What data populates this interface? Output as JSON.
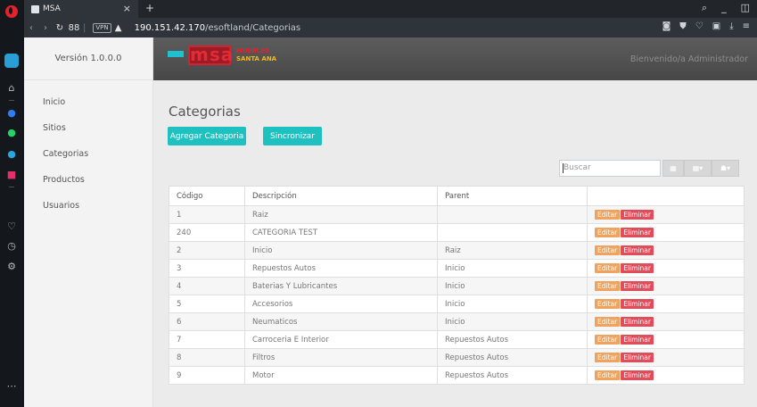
{
  "browser": {
    "tab_title": "MSA",
    "tab_close": "×",
    "new_tab": "+",
    "speed_dial": "88",
    "vpn_label": "VPN",
    "url_host": "190.151.42.170",
    "url_path": "/esoftland/Categorias"
  },
  "sidebar": {
    "version": "Versión 1.0.0.0",
    "items": [
      {
        "label": "Inicio"
      },
      {
        "label": "Sitios"
      },
      {
        "label": "Categorias"
      },
      {
        "label": "Productos"
      },
      {
        "label": "Usuarios"
      }
    ]
  },
  "header": {
    "logo_text": "msa",
    "logo_sub_line1": "MUEBLES",
    "logo_sub_line2": "SANTA ANA",
    "welcome": "Bienvenido/a Administrador"
  },
  "main": {
    "title": "Categorias",
    "add_button": "Agregar Categoria",
    "sync_button": "Sincronizar",
    "search_placeholder": "Buscar",
    "table": {
      "headers": [
        "Código",
        "Descripción",
        "Parent",
        ""
      ],
      "edit_label": "Editar",
      "delete_label": "Eliminar",
      "rows": [
        {
          "codigo": "1",
          "descripcion": "Raiz",
          "parent": ""
        },
        {
          "codigo": "240",
          "descripcion": "CATEGORIA TEST",
          "parent": ""
        },
        {
          "codigo": "2",
          "descripcion": "Inicio",
          "parent": "Raiz"
        },
        {
          "codigo": "3",
          "descripcion": "Repuestos Autos",
          "parent": "Inicio"
        },
        {
          "codigo": "4",
          "descripcion": "Baterias Y Lubricantes",
          "parent": "Inicio"
        },
        {
          "codigo": "5",
          "descripcion": "Accesorios",
          "parent": "Inicio"
        },
        {
          "codigo": "6",
          "descripcion": "Neumaticos",
          "parent": "Inicio"
        },
        {
          "codigo": "7",
          "descripcion": "Carroceria E Interior",
          "parent": "Repuestos Autos"
        },
        {
          "codigo": "8",
          "descripcion": "Filtros",
          "parent": "Repuestos Autos"
        },
        {
          "codigo": "9",
          "descripcion": "Motor",
          "parent": "Repuestos Autos"
        }
      ]
    }
  },
  "colors": {
    "accent": "#1fc1c0",
    "edit": "#f0a35c",
    "delete": "#e24b59"
  }
}
